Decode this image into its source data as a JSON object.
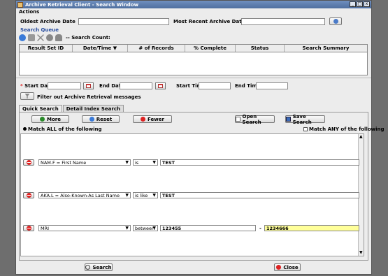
{
  "window": {
    "title": "Archive Retrieval Client  - Search Window",
    "btn_min": "_",
    "btn_max": "□",
    "btn_close": "x"
  },
  "menu": {
    "actions": "Actions"
  },
  "archive": {
    "oldest_label": "Oldest Archive Date",
    "recent_label": "Most Recent Archive Date"
  },
  "search_queue": {
    "title": "Search Queue",
    "count_label": "-- Search Count:",
    "columns": [
      "Result Set ID",
      "Date/Time ▼",
      "# of Records",
      "% Complete",
      "Status",
      "Search Summary"
    ]
  },
  "dates": {
    "start_date": "Start Date",
    "end_date": "End Date",
    "start_time": "Start Time",
    "end_time": "End Time",
    "filter_label": "Filter out Archive Retrieval messages",
    "required_mark": "*"
  },
  "tabs": [
    {
      "label": "Quick Search"
    },
    {
      "label": "Detail Index Search"
    }
  ],
  "buttons": {
    "more": "More",
    "reset": "Reset",
    "fewer": "Fewer",
    "open_search": "Open Search",
    "save_search": "Save Search",
    "search": "Search",
    "close": "Close"
  },
  "match": {
    "all": "Match ALL of the following",
    "any": "Match ANY of the following"
  },
  "criteria": [
    {
      "field": "NAM.F = First Name",
      "op": "is",
      "value": "TEST"
    },
    {
      "field": "AKA.L = Also-Known-As Last Name",
      "op": "is like",
      "value": "TEST"
    },
    {
      "field": "MRI",
      "op": "between",
      "value": "123455",
      "dash": "-",
      "value2": "1234666"
    }
  ],
  "colors": {
    "accent": "#2a4fa0",
    "highlight": "#ffff99",
    "danger": "#d22222",
    "ok": "#2a8a2a"
  }
}
